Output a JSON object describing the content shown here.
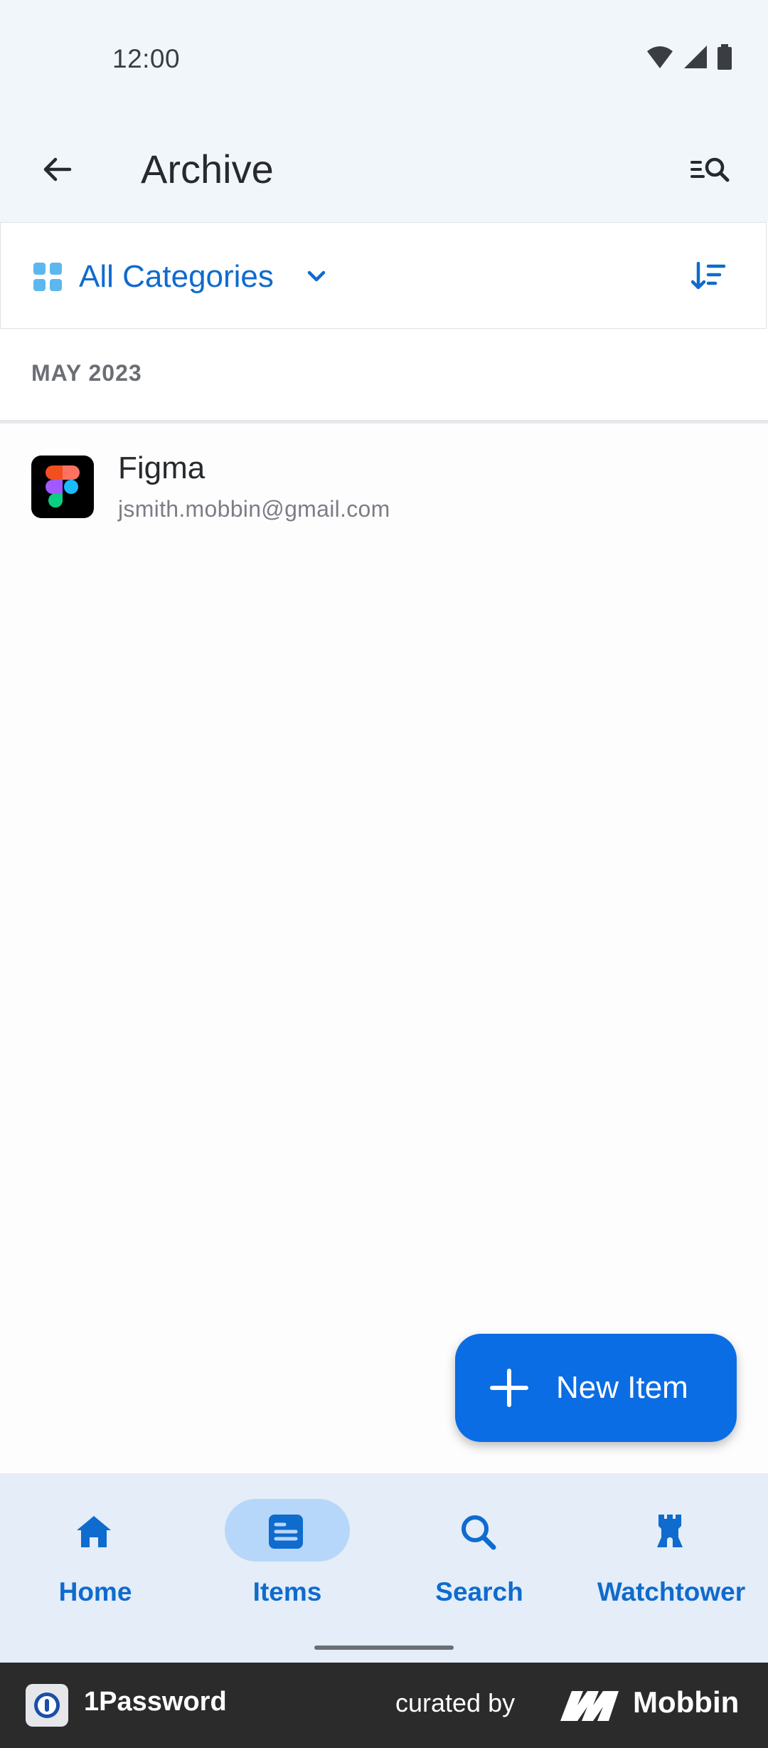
{
  "status_bar": {
    "time": "12:00"
  },
  "header": {
    "title": "Archive"
  },
  "filter": {
    "category_label": "All Categories"
  },
  "section": {
    "label": "MAY 2023"
  },
  "items": [
    {
      "title": "Figma",
      "subtitle": "jsmith.mobbin@gmail.com",
      "icon": "figma-icon"
    }
  ],
  "fab": {
    "label": "New Item"
  },
  "bottom_nav": [
    {
      "label": "Home",
      "icon": "home-icon",
      "active": false
    },
    {
      "label": "Items",
      "icon": "items-icon",
      "active": true
    },
    {
      "label": "Search",
      "icon": "search-icon",
      "active": false
    },
    {
      "label": "Watchtower",
      "icon": "watchtower-icon",
      "active": false
    }
  ],
  "footer": {
    "app_name": "1Password",
    "curated_by": "curated by",
    "brand": "Mobbin"
  },
  "colors": {
    "accent": "#0b6de3",
    "nav_bg": "#e4edf8",
    "active_pill": "#b7d7fa",
    "app_bar_bg": "#f1f6fb"
  }
}
